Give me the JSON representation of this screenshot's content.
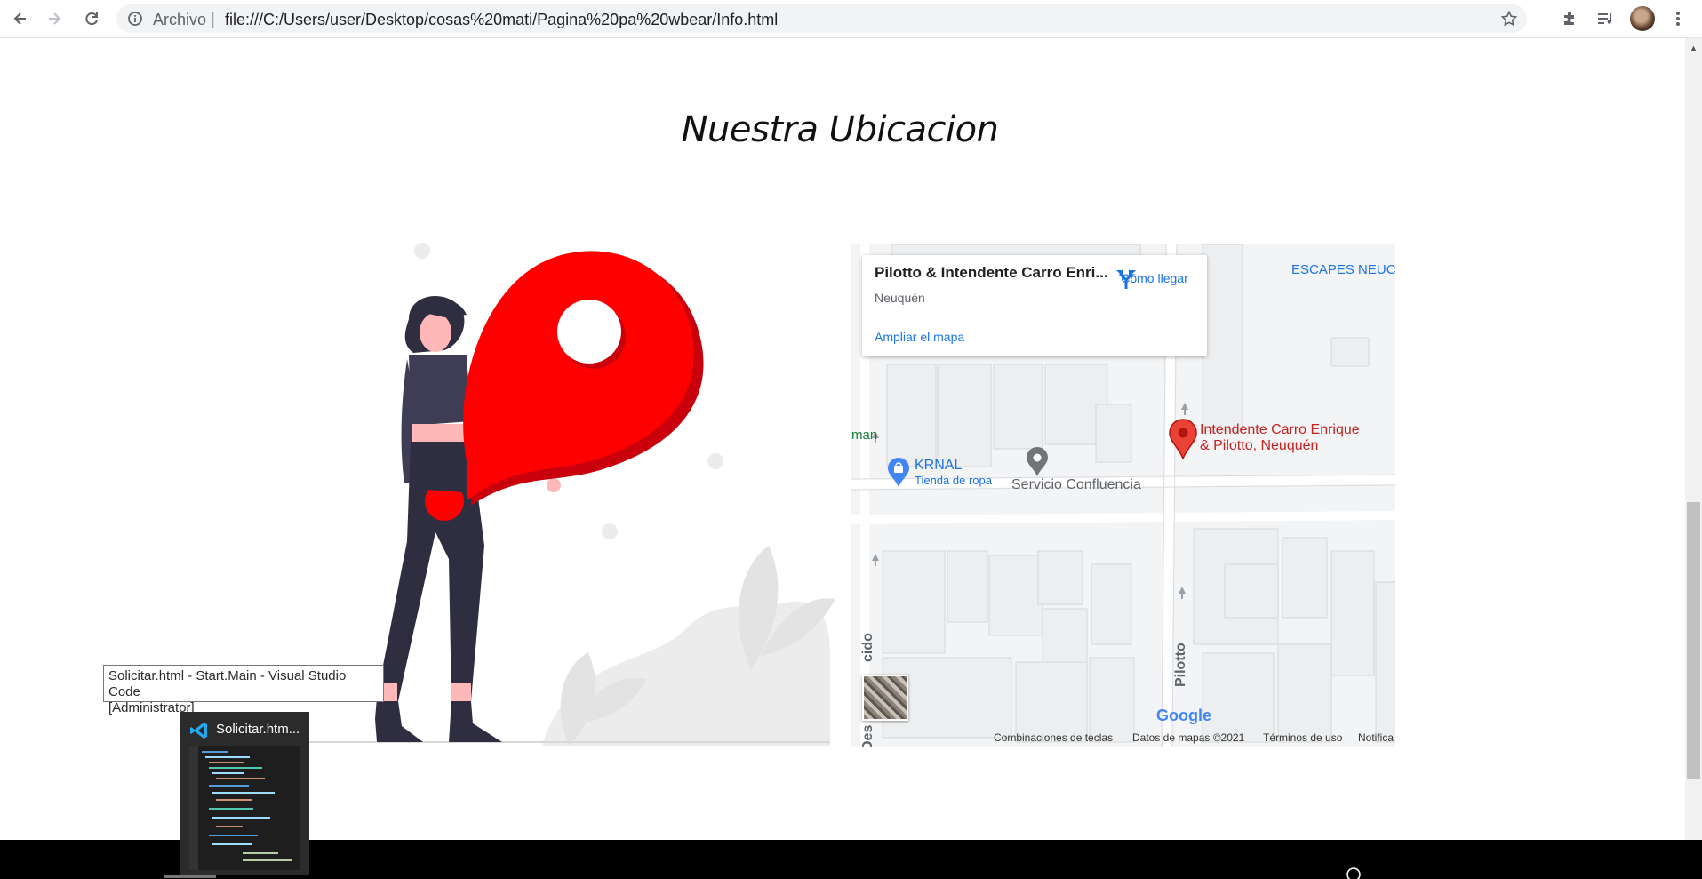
{
  "browser": {
    "address_scheme": "Archivo",
    "address_separator": "|",
    "url": "file:///C:/Users/user/Desktop/cosas%20mati/Pagina%20pa%20wbear/Info.html",
    "icons": [
      "back-arrow-icon",
      "forward-arrow-icon",
      "reload-icon",
      "info-icon",
      "star-icon",
      "extensions-icon",
      "media-control-icon",
      "profile-avatar",
      "menu-dots-icon"
    ]
  },
  "page": {
    "heading": "Nuestra Ubicacion"
  },
  "map": {
    "place_title": "Pilotto & Intendente Carro Enri...",
    "place_city": "Neuquén",
    "directions_label": "Cómo llegar",
    "enlarge_label": "Ampliar el mapa",
    "top_right_label": "ESCAPES NEUC",
    "left_edge_label": "man",
    "marker_label_line1": "Intendente Carro Enrique",
    "marker_label_line2": "& Pilotto, Neuquén",
    "poi_krnal_name": "KRNAL",
    "poi_krnal_type": "Tienda de ropa",
    "poi_servicio": "Servicio Confluencia",
    "street_pilotto": "Pilotto",
    "street_left": "Des",
    "street_left2": "cido",
    "logo_text": "Google",
    "attribution": {
      "shortcuts": "Combinaciones de teclas",
      "data": "Datos de mapas ©2021",
      "terms": "Términos de uso",
      "report": "Notifica"
    },
    "colors": {
      "marker": "#ea4335",
      "link": "#1a73e8",
      "poi_blue": "#4285f4"
    }
  },
  "taskbar": {
    "tooltip_line1": "Solicitar.html - Start.Main - Visual Studio Code",
    "tooltip_line2": "[Administrator]",
    "preview_title": "Solicitar.htm..."
  },
  "illustration": {
    "colors": {
      "pin": "#ff0000",
      "pin_shadow": "#c9000b",
      "hair": "#2f2e41",
      "skin": "#ffb8b8",
      "decor": "#ececec"
    }
  }
}
